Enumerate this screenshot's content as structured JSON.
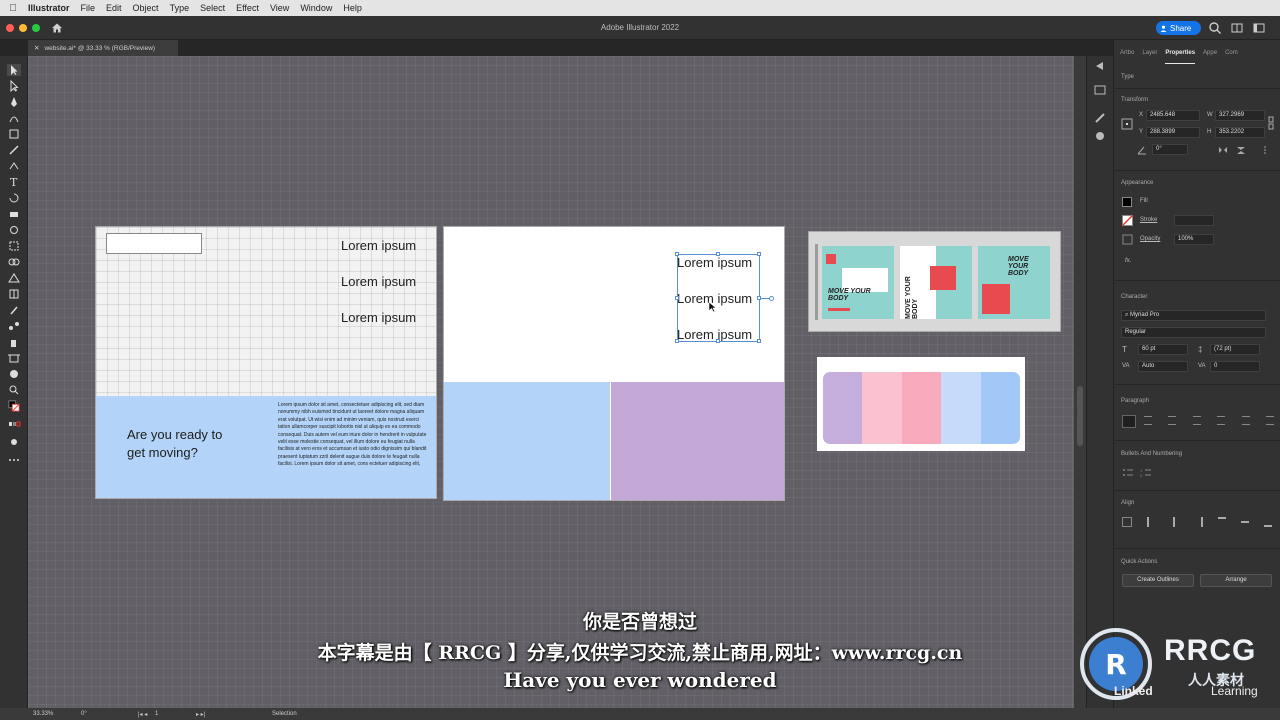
{
  "menubar": {
    "items": [
      "Illustrator",
      "File",
      "Edit",
      "Object",
      "Type",
      "Select",
      "Effect",
      "View",
      "Window",
      "Help"
    ]
  },
  "titlebar": {
    "title": "Adobe Illustrator 2022",
    "share": "Share"
  },
  "document_tab": {
    "label": "website.ai* @ 33.33 % (RGB/Preview)"
  },
  "canvas": {
    "artboard1": {
      "top_items": [
        "Lorem ipsum",
        "Lorem ipsum",
        "Lorem ipsum"
      ],
      "headline": [
        "Are you ready to",
        "get moving?"
      ],
      "paragraph": "Lorem ipsum dolor sit amet, consectetuer adipiscing elit, sed diam nonummy nibh euismod tincidunt ut laoreet dolore magna aliquam erat volutpat. Ut wisi enim ad minim veniam, quis nostrud exerci tation ullamcorper suscipit lobortis nisl ut aliquip ex ea commodo consequat. Duis autem vel eum iriure dolor in hendrerit in vulputate velit esse molestie consequat, vel illum dolore eu feugiat nulla facilisis at vero eros et accumsan et iusto odio dignissim qui blandit praesent luptatum zzril delenit augue duis dolore te feugait nulla facilisi.",
      "paragraph_last": "Lorem ipsum dolor sit amet, cons ectetuer adipiscing elit,"
    },
    "artboard2": {
      "top_items": [
        "Lorem ipsum",
        "Lorem ipsum",
        "Lorem ipsum"
      ]
    },
    "posters": [
      {
        "lines": [
          "MOVE YOUR",
          "BODY"
        ]
      },
      {
        "lines": [
          "MOVE",
          "YOUR",
          "BODY"
        ]
      },
      {
        "lines": [
          "MOVE",
          "YOUR",
          "BODY"
        ]
      }
    ],
    "palette": [
      "#c5aedb",
      "#fcc1d0",
      "#f8a9bb",
      "#c4dcfa",
      "#a2c8f7"
    ],
    "colors": {
      "blue": "#b3d4f8",
      "purple": "#c4a8d8",
      "teal": "#8fd3cf",
      "red": "#e84a4f"
    }
  },
  "panel": {
    "tabs": [
      "Artbo",
      "Layer",
      "Properties",
      "Appe",
      "Com"
    ],
    "active_tab": "Properties",
    "type_label": "Type",
    "transform": {
      "title": "Transform",
      "x_label": "X",
      "x": "2485.648",
      "y_label": "Y",
      "y": "288.3899",
      "w_label": "W",
      "w": "327.2969",
      "h_label": "H",
      "h": "353.2202",
      "angle": "0°"
    },
    "appearance": {
      "title": "Appearance",
      "fill": "Fill",
      "stroke": "Stroke",
      "opacity_label": "Opacity",
      "opacity": "100%",
      "fx": "fx."
    },
    "character": {
      "title": "Character",
      "font": "Myriad Pro",
      "style": "Regular",
      "size": "60 pt",
      "leading": "(72 pt)",
      "kerning": "Auto",
      "tracking": "0"
    },
    "paragraph": {
      "title": "Paragraph"
    },
    "bullets": {
      "title": "Bullets And Numbering"
    },
    "align": {
      "title": "Align"
    },
    "quick_actions": {
      "title": "Quick Actions",
      "create_outlines": "Create Outlines",
      "arrange": "Arrange"
    }
  },
  "statusbar": {
    "zoom": "33.33%",
    "angle": "0°",
    "artboard": "1",
    "tool": "Selection"
  },
  "subtitles": {
    "line1": "你是否曾想过",
    "line2": "本字幕是由【 RRCG 】分享,仅供学习交流,禁止商用,网址：www.rrcg.cn",
    "line3": "Have you ever wondered"
  },
  "watermark": {
    "brand": "RRCG",
    "sub": "人人素材",
    "linkedin": "Linked",
    "learning": "Learning"
  }
}
